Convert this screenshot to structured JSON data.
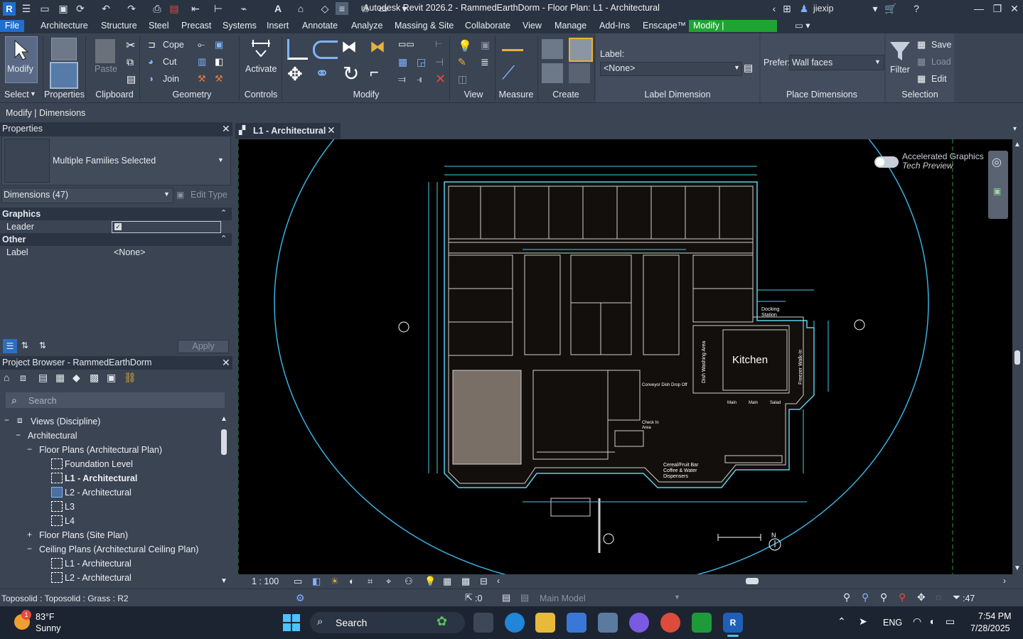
{
  "window": {
    "title": "Autodesk Revit 2026.2 - RammedEarthDorm - Floor Plan: L1 - Architectural",
    "user": "jiexip"
  },
  "menu_tabs": [
    "File",
    "Architecture",
    "Structure",
    "Steel",
    "Precast",
    "Systems",
    "Insert",
    "Annotate",
    "Analyze",
    "Massing & Site",
    "Collaborate",
    "View",
    "Manage",
    "Add-Ins",
    "Enscape™",
    "Modify | Dimensions"
  ],
  "ribbon": {
    "select": {
      "modify_label": "Modify",
      "select_label": "Select"
    },
    "properties_label": "Properties",
    "clipboard": {
      "paste_label": "Paste",
      "title": "Clipboard"
    },
    "geometry": {
      "cope": "Cope",
      "cut": "Cut",
      "join": "Join",
      "title": "Geometry"
    },
    "controls": {
      "activate": "Activate",
      "title": "Controls"
    },
    "modify_title": "Modify",
    "view_title": "View",
    "measure_title": "Measure",
    "create_title": "Create",
    "label_dimension": {
      "label_caption": "Label:",
      "value": "<None>",
      "title": "Label Dimension"
    },
    "place_dimensions": {
      "prefer_caption": "Prefer:",
      "prefer_value": "Wall faces",
      "title": "Place Dimensions"
    },
    "selection": {
      "filter": "Filter",
      "save": "Save",
      "load": "Load",
      "edit": "Edit",
      "title": "Selection"
    }
  },
  "options_bar": {
    "context": "Modify | Dimensions"
  },
  "properties": {
    "title": "Properties",
    "type_name": "Multiple Families Selected",
    "selector": "Dimensions (47)",
    "edit_type": "Edit Type",
    "groups": [
      {
        "name": "Graphics",
        "rows": [
          {
            "name": "Leader",
            "value": ""
          }
        ]
      },
      {
        "name": "Other",
        "rows": [
          {
            "name": "Label",
            "value": "<None>"
          }
        ]
      }
    ],
    "apply": "Apply"
  },
  "project_browser": {
    "title": "Project Browser - RammedEarthDorm",
    "search_placeholder": "Search",
    "items": [
      "Views (Discipline)",
      "Architectural",
      "Floor Plans (Architectural Plan)",
      "Foundation Level",
      "L1 - Architectural",
      "L2 - Architectural",
      "L3",
      "L4",
      "Floor Plans (Site Plan)",
      "Ceiling Plans (Architectural Ceiling Plan)",
      "L1 - Architectural",
      "L2 - Architectural"
    ]
  },
  "view": {
    "tab_title": "L1 - Architectural",
    "accelerated_line1": "Accelerated Graphics",
    "accelerated_line2": "Tech Preview",
    "scale": "1 : 100",
    "plan_labels": {
      "kitchen": "Kitchen",
      "docking_line1": "Docking",
      "docking_line2": "Station",
      "dish_washing": "Dish Washing Area",
      "freezer": "Freezer Walk-In",
      "conveyor": "Conveyor Dish Drop Off",
      "check_line1": "Check In",
      "check_line2": "Area",
      "cereal_line1": "Cereal/Fruit Bar",
      "cereal_line2": "Coffee & Water",
      "cereal_line3": "Dispensers",
      "main1": "Main",
      "main2": "Main",
      "salad": "Salad",
      "north": "N"
    }
  },
  "status": {
    "left": "Toposolid : Toposolid : Grass : R2",
    "sel_count": ":0",
    "model": "Main Model",
    "filter_count": ":47"
  },
  "taskbar": {
    "weather_temp": "83°F",
    "weather_desc": "Sunny",
    "search": "Search",
    "lang": "ENG",
    "time": "7:54 PM",
    "date": "7/28/2025",
    "badge": "1"
  }
}
